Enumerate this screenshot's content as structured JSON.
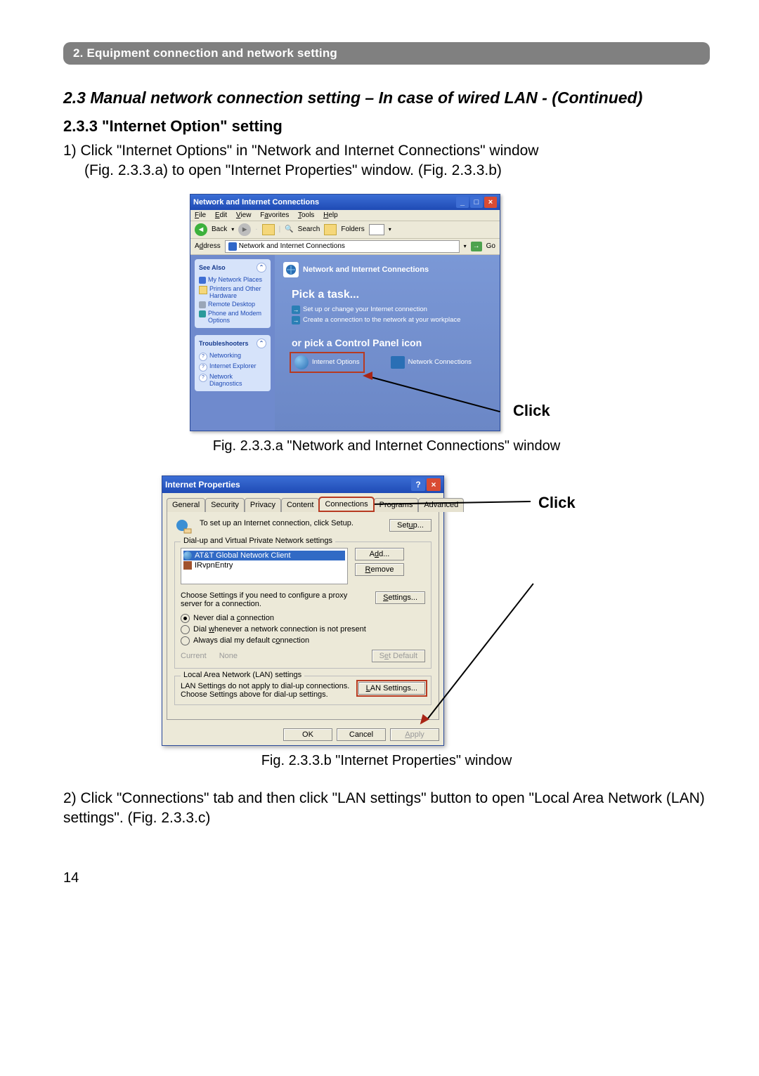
{
  "chapter_bar": "2. Equipment connection and network setting",
  "section_heading": "2.3 Manual network connection setting – In case of wired LAN - (Continued)",
  "subsection": "2.3.3 \"Internet Option\" setting",
  "step1_line1": "1) Click \"Internet Options\" in \"Network and Internet Connections\" window",
  "step1_line2": "(Fig. 2.3.3.a) to open \"Internet Properties\" window. (Fig. 2.3.3.b)",
  "figA_caption": "Fig. 2.3.3.a \"Network and Internet Connections\" window",
  "figB_caption": "Fig. 2.3.3.b \"Internet Properties\" window",
  "step2": "2) Click \"Connections\" tab and then click \"LAN settings\" button to open \"Local Area Network (LAN) settings\". (Fig. 2.3.3.c)",
  "page_number": "14",
  "click_label": "Click",
  "figA": {
    "title": "Network and Internet Connections",
    "menu": [
      "File",
      "Edit",
      "View",
      "Favorites",
      "Tools",
      "Help"
    ],
    "toolbar": {
      "back": "Back",
      "search": "Search",
      "folders": "Folders"
    },
    "address_label": "Address",
    "address_value": "Network and Internet Connections",
    "go_label": "Go",
    "see_also": {
      "title": "See Also",
      "items": [
        "My Network Places",
        "Printers and Other Hardware",
        "Remote Desktop",
        "Phone and Modem Options"
      ]
    },
    "troubleshooters": {
      "title": "Troubleshooters",
      "items": [
        "Networking",
        "Internet Explorer",
        "Network Diagnostics"
      ]
    },
    "main_header": "Network and Internet Connections",
    "pick_task": "Pick a task...",
    "task1": "Set up or change your Internet connection",
    "task2": "Create a connection to the network at your workplace",
    "pick_icon": "or pick a Control Panel icon",
    "icon_internet": "Internet Options",
    "icon_network": "Network Connections"
  },
  "figB": {
    "title": "Internet Properties",
    "tabs": [
      "General",
      "Security",
      "Privacy",
      "Content",
      "Connections",
      "Programs",
      "Advanced"
    ],
    "setup_text": "To set up an Internet connection, click Setup.",
    "setup_btn": "Setup...",
    "group_dial": "Dial-up and Virtual Private Network settings",
    "list_items": [
      "AT&T Global Network Client",
      "IRvpnEntry"
    ],
    "add_btn": "Add...",
    "remove_btn": "Remove",
    "proxy_text": "Choose Settings if you need to configure a proxy server for a connection.",
    "settings_btn": "Settings...",
    "radio_never": "Never dial a connection",
    "radio_dialwhen": "Dial whenever a network connection is not present",
    "radio_always": "Always dial my default connection",
    "current_label": "Current",
    "current_value": "None",
    "setdefault_btn": "Set Default",
    "group_lan": "Local Area Network (LAN) settings",
    "lan_text": "LAN Settings do not apply to dial-up connections. Choose Settings above for dial-up settings.",
    "lan_btn": "LAN Settings...",
    "ok": "OK",
    "cancel": "Cancel",
    "apply": "Apply"
  }
}
